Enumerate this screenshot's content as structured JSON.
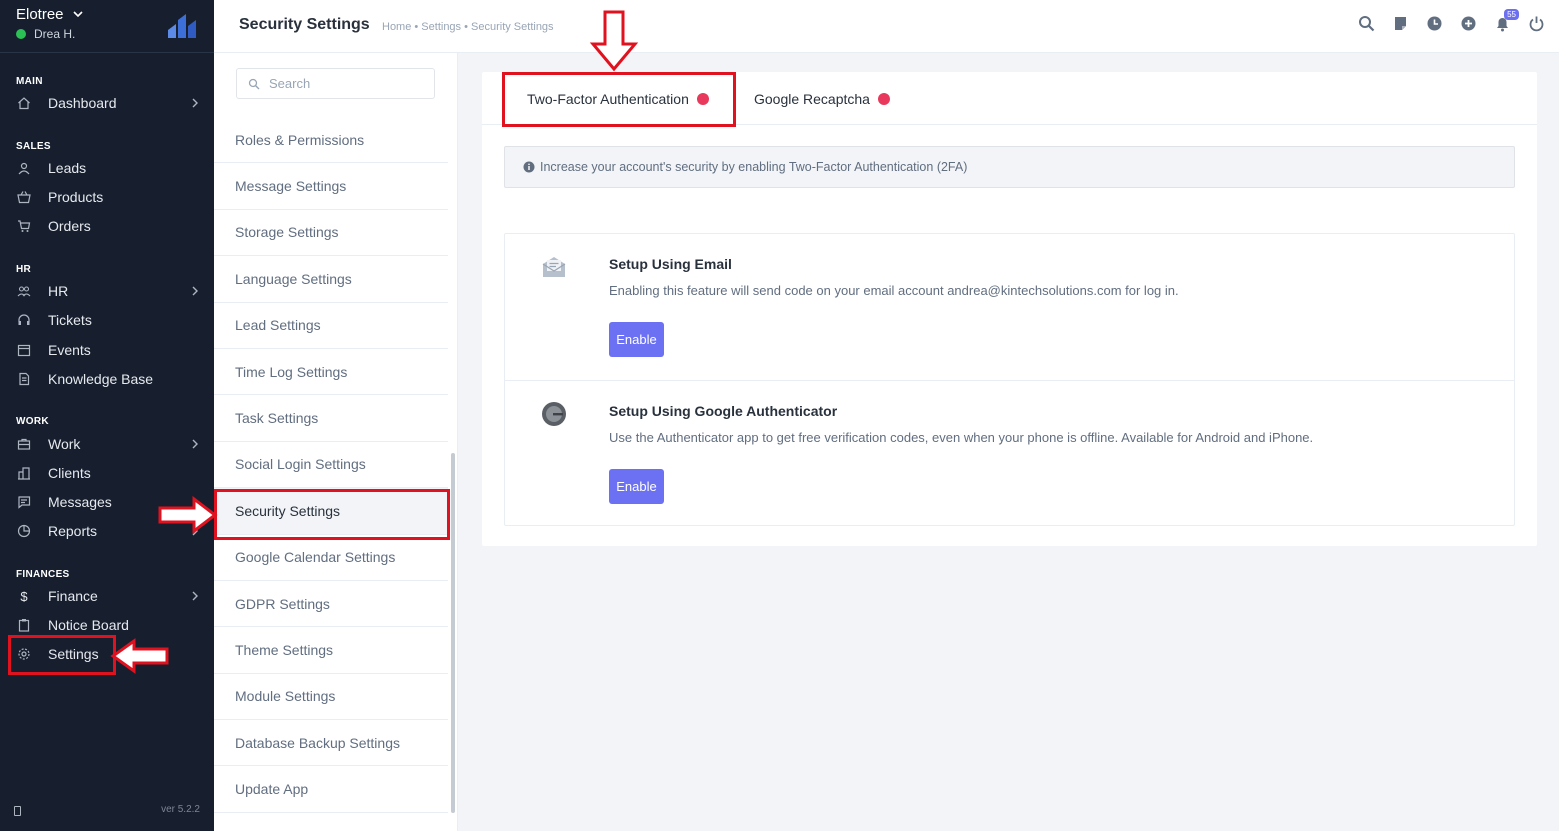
{
  "brand": {
    "name": "Elotree",
    "user": "Drea H."
  },
  "sidebar": {
    "sections": [
      {
        "label": "MAIN"
      },
      {
        "label": "SALES"
      },
      {
        "label": "HR"
      },
      {
        "label": "WORK"
      },
      {
        "label": "FINANCES"
      }
    ],
    "items": [
      {
        "label": "Dashboard",
        "icon": "home-icon"
      },
      {
        "label": "Leads",
        "icon": "user-icon"
      },
      {
        "label": "Products",
        "icon": "basket-icon"
      },
      {
        "label": "Orders",
        "icon": "cart-icon"
      },
      {
        "label": "HR",
        "icon": "people-icon"
      },
      {
        "label": "Tickets",
        "icon": "headset-icon"
      },
      {
        "label": "Events",
        "icon": "calendar-icon"
      },
      {
        "label": "Knowledge Base",
        "icon": "document-icon"
      },
      {
        "label": "Work",
        "icon": "briefcase-icon"
      },
      {
        "label": "Clients",
        "icon": "building-icon"
      },
      {
        "label": "Messages",
        "icon": "message-icon"
      },
      {
        "label": "Reports",
        "icon": "pie-chart-icon"
      },
      {
        "label": "Finance",
        "icon": "dollar-icon"
      },
      {
        "label": "Notice Board",
        "icon": "clipboard-icon"
      },
      {
        "label": "Settings",
        "icon": "gear-icon"
      }
    ],
    "version": "ver 5.2.2"
  },
  "header": {
    "title": "Security Settings",
    "breadcrumb": "Home • Settings • Security Settings",
    "notification_count": "55"
  },
  "settings_menu": {
    "search_placeholder": "Search",
    "items": [
      "Roles & Permissions",
      "Message Settings",
      "Storage Settings",
      "Language Settings",
      "Lead Settings",
      "Time Log Settings",
      "Task Settings",
      "Social Login Settings",
      "Security Settings",
      "Google Calendar Settings",
      "GDPR Settings",
      "Theme Settings",
      "Module Settings",
      "Database Backup Settings",
      "Update App"
    ],
    "active": "Security Settings"
  },
  "main": {
    "tabs": [
      {
        "label": "Two-Factor Authentication"
      },
      {
        "label": "Google Recaptcha"
      }
    ],
    "info": "Increase your account's security by enabling Two-Factor Authentication (2FA)",
    "methods": [
      {
        "title": "Setup Using Email",
        "description": "Enabling this feature will send code on your email account andrea@kintechsolutions.com for log in.",
        "button": "Enable",
        "icon": "email-icon"
      },
      {
        "title": "Setup Using Google Authenticator",
        "description": "Use the Authenticator app to get free verification codes, even when your phone is offline. Available for Android and iPhone.",
        "button": "Enable",
        "icon": "google-authenticator-icon"
      }
    ]
  },
  "colors": {
    "sidebar_bg": "#171f2e",
    "accent": "#6b71f2",
    "status_dot": "#e8395c",
    "online": "#2bc155",
    "annotation": "#e0121f"
  }
}
